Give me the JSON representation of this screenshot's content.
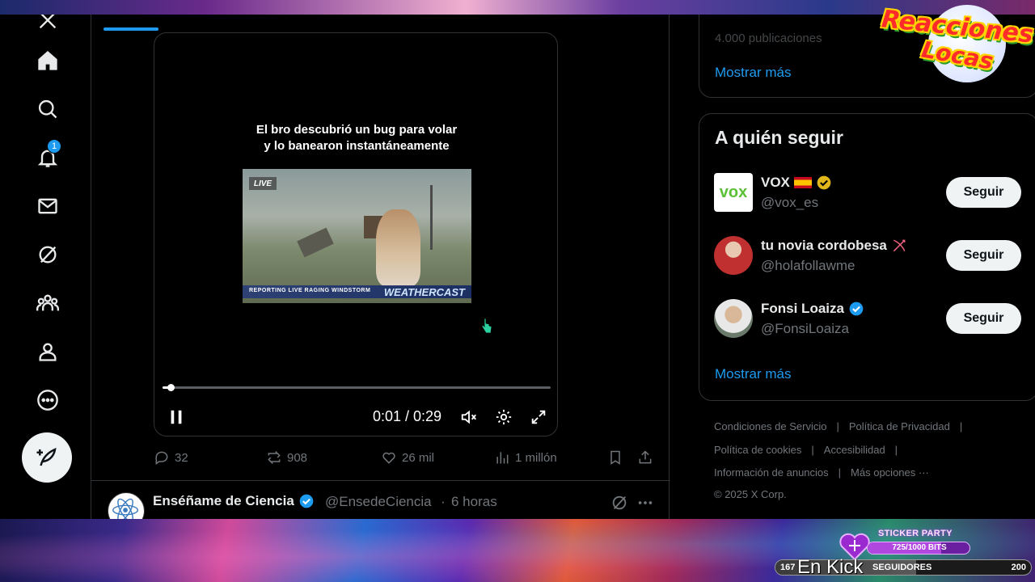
{
  "nav": {
    "notifications_badge": "1",
    "items": [
      "home-icon",
      "search-icon",
      "bell-icon",
      "mail-icon",
      "grok-icon",
      "communities-icon",
      "profile-icon",
      "more-icon"
    ]
  },
  "video": {
    "caption_line1": "El bro descubrió un bug para volar",
    "caption_line2": "y lo banearon instantáneamente",
    "clip_live": "LIVE",
    "clip_lower_text": "REPORTING LIVE   RAGING WINDSTORM",
    "clip_brand": "WEATHERCAST",
    "time": "0:01 / 0:29",
    "progress": 0.02
  },
  "actions": {
    "replies": "32",
    "reposts": "908",
    "likes": "26 mil",
    "views": "1 millón"
  },
  "next_post": {
    "name": "Enséñame de Ciencia",
    "handle": "@EnsedeCiencia",
    "dot": "·",
    "time": "6 horas"
  },
  "trends": {
    "faded": "4.000 publicaciones",
    "more": "Mostrar más"
  },
  "who_to_follow": {
    "title": "A quién seguir",
    "button": "Seguir",
    "more": "Mostrar más",
    "accounts": [
      {
        "name": "VOX",
        "handle": "@vox_es",
        "avatar_text": "vox"
      },
      {
        "name": "tu novia cordobesa",
        "handle": "@holafollawme"
      },
      {
        "name": "Fonsi Loaiza",
        "handle": "@FonsiLoaiza"
      }
    ]
  },
  "footer": {
    "terms": "Condiciones de Servicio",
    "privacy": "Política de Privacidad",
    "cookies": "Política de cookies",
    "accessibility": "Accesibilidad",
    "ads": "Información de anuncios",
    "more": "Más opciones ···",
    "sep": "|",
    "copyright": "© 2025 X Corp."
  },
  "overlay": {
    "logo_line1": "Reacciones",
    "logo_line2": "Locas",
    "sticker_title": "STICKER PARTY",
    "sticker_label": "725/1000 BITS",
    "sticker_progress": 0.725,
    "followers_start": "167",
    "followers_label": "SEGUIDORES",
    "followers_end": "200",
    "followers_progress": 0.55,
    "en_kick": "En Kick"
  },
  "colors": {
    "accent": "#1d9bf0",
    "background": "#000000",
    "text": "#e7e9ea",
    "muted": "#71767b"
  }
}
